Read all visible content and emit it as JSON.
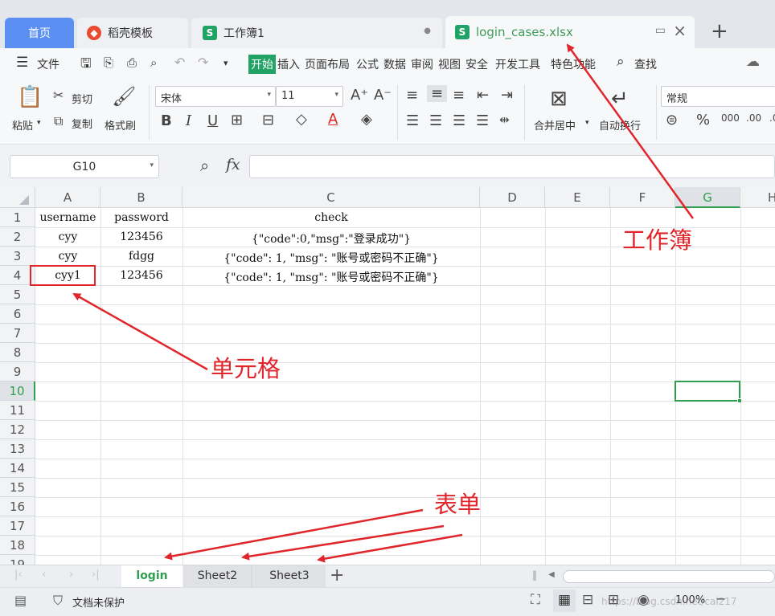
{
  "tabs": [
    {
      "label": "首页"
    },
    {
      "label": "稻壳模板"
    },
    {
      "label": "工作簿1"
    },
    {
      "label": "login_cases.xlsx"
    }
  ],
  "menu": {
    "file": "文件",
    "items": [
      "开始",
      "插入",
      "页面布局",
      "公式",
      "数据",
      "审阅",
      "视图",
      "安全",
      "开发工具",
      "特色功能"
    ],
    "search": "查找"
  },
  "ribbon": {
    "paste": "粘贴",
    "cut": "剪切",
    "copy": "复制",
    "format_painter": "格式刷",
    "font_name": "宋体",
    "font_size": "11",
    "merge_center": "合并居中",
    "wrap_text": "自动换行",
    "number_format": "常规"
  },
  "formula_bar": {
    "cell_ref": "G10",
    "fx": "fx",
    "content": ""
  },
  "grid": {
    "columns": [
      "A",
      "B",
      "C",
      "D",
      "E",
      "F",
      "G",
      "H"
    ],
    "rows": [
      "1",
      "2",
      "3",
      "4",
      "5",
      "6",
      "7",
      "8",
      "9",
      "10",
      "11",
      "12",
      "13",
      "14",
      "15",
      "16",
      "17",
      "18",
      "19"
    ],
    "selected_cell": "G10",
    "data": [
      [
        "username",
        "password",
        "check"
      ],
      [
        "cyy",
        "123456",
        "{\"code\":0,\"msg\":\"登录成功\"}"
      ],
      [
        "cyy",
        "fdgg",
        "{\"code\": 1, \"msg\": \"账号或密码不正确\"}"
      ],
      [
        "cyy1",
        "123456",
        "{\"code\": 1, \"msg\": \"账号或密码不正确\"}"
      ]
    ]
  },
  "sheets": [
    "login",
    "Sheet2",
    "Sheet3"
  ],
  "active_sheet": "login",
  "status": {
    "protect": "文档未保护",
    "zoom": "100%",
    "watermark": "https://blog.csdn.net/cal217"
  },
  "annotations": {
    "workbook": "工作簿",
    "cell": "单元格",
    "sheet": "表单"
  },
  "colors": {
    "accent": "#21a366",
    "annotation": "#e0262b",
    "home_tab": "#5b8ff2"
  }
}
